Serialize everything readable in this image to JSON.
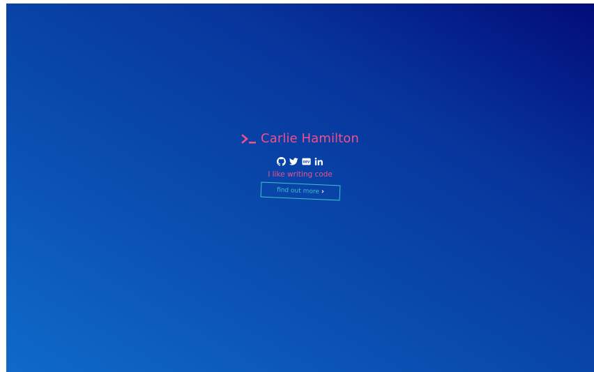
{
  "hero": {
    "title": "Carlie Hamilton",
    "tagline": "I like writing code",
    "cta_label": "find out more",
    "cta_chevron": "›"
  },
  "icons": {
    "prompt": "terminal-prompt-icon",
    "socials": [
      "github-icon",
      "twitter-icon",
      "dev-icon",
      "linkedin-icon"
    ],
    "cta": "chevron-right-icon"
  },
  "colors": {
    "accent_pink": "#f0508a",
    "accent_teal": "#3cc3c8",
    "icon_white": "#ffffff",
    "bg_gradient_start": "#0f6ac9",
    "bg_gradient_end": "#020c7a"
  }
}
